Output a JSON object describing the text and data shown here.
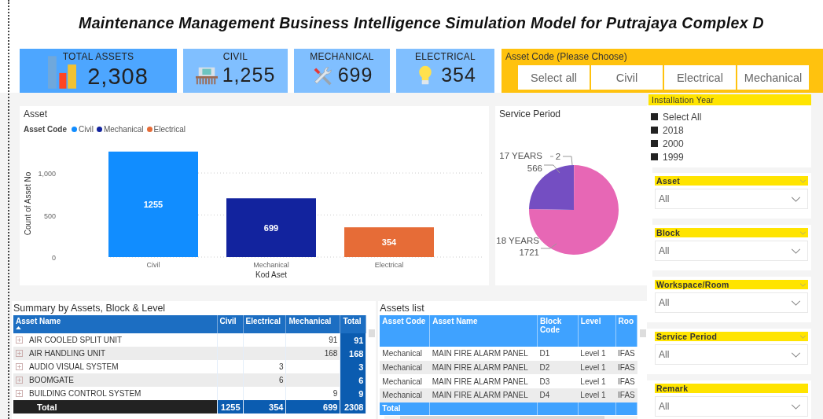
{
  "title": "Maintenance Management Business Intelligence Simulation Model for Putrajaya Complex D",
  "kpis": [
    {
      "label": "TOTAL ASSETS",
      "value": "2,308",
      "kind": "total"
    },
    {
      "label": "CIVIL",
      "value": "1,255",
      "kind": "civil"
    },
    {
      "label": "MECHANICAL",
      "value": "699",
      "kind": "mechanical"
    },
    {
      "label": "ELECTRICAL",
      "value": "354",
      "kind": "electrical"
    }
  ],
  "asset_code_slicer": {
    "title": "Asset Code (Please Choose)",
    "options": [
      {
        "label": "Select all",
        "selected": false
      },
      {
        "label": "Civil",
        "selected": false
      },
      {
        "label": "Electrical",
        "selected": false
      },
      {
        "label": "Mechanical",
        "selected": false
      }
    ]
  },
  "asset_chart": {
    "title": "Asset",
    "legend_title": "Asset Code",
    "chart_data": {
      "type": "bar",
      "xlabel": "Kod Aset",
      "ylabel": "Count of Asset No",
      "categories": [
        "Civil",
        "Mechanical",
        "Electrical"
      ],
      "series": [
        {
          "name": "Civil",
          "color": "#118dff",
          "values": [
            1255,
            null,
            null
          ]
        },
        {
          "name": "Mechanical",
          "color": "#12239e",
          "values": [
            null,
            699,
            null
          ]
        },
        {
          "name": "Electrical",
          "color": "#e66c37",
          "values": [
            null,
            null,
            354
          ]
        }
      ],
      "ylim": [
        0,
        1300
      ],
      "yticks": [
        0,
        500,
        {
          "value": 1000,
          "label": "1,000"
        }
      ],
      "data_labels": true
    }
  },
  "service_period": {
    "title": "Service Period",
    "chart_data": {
      "type": "pie",
      "categories": [
        null,
        "18 YEARS",
        "17 YEARS"
      ],
      "values": [
        2,
        1721,
        566
      ],
      "colors": [
        "#d9534f",
        "#e767b5",
        "#744ec2"
      ],
      "value_labels": [
        "2",
        "1721",
        "566"
      ]
    }
  },
  "installation_year": {
    "title": "Installation Year",
    "items": [
      {
        "label": "Select All",
        "checked": true
      },
      {
        "label": "2018",
        "checked": true
      },
      {
        "label": "2000",
        "checked": true
      },
      {
        "label": "1999",
        "checked": true
      }
    ]
  },
  "dropdowns": [
    {
      "label": "Asset",
      "value": "All",
      "header_chevron": true
    },
    {
      "label": "Block",
      "value": "All",
      "header_chevron": true
    },
    {
      "label": "Workspace/Room",
      "value": "All",
      "header_chevron": true
    },
    {
      "label": "Service Period",
      "value": "All",
      "header_chevron": true
    },
    {
      "label": "Remark",
      "value": "All",
      "header_chevron": false
    }
  ],
  "summary": {
    "title": "Summary by Assets, Block & Level",
    "columns": [
      {
        "label": "Asset Name",
        "sorted": true
      },
      {
        "label": "Civil",
        "sorted": false
      },
      {
        "label": "Electrical",
        "sorted": false
      },
      {
        "label": "Mechanical",
        "sorted": false
      },
      {
        "label": "Total",
        "sorted": false
      }
    ],
    "rows": [
      [
        "AIR COOLED SPLIT UNIT",
        null,
        null,
        "91",
        "91"
      ],
      [
        "AIR HANDLING UNIT",
        null,
        null,
        "168",
        "168"
      ],
      [
        "AUDIO VISUAL SYSTEM",
        null,
        "3",
        null,
        "3"
      ],
      [
        "BOOMGATE",
        null,
        "6",
        null,
        "6"
      ],
      [
        "BUILDING CONTROL SYSTEM",
        null,
        null,
        "9",
        "9"
      ]
    ],
    "total_row": [
      "Total",
      "1255",
      "354",
      "699",
      "2308"
    ]
  },
  "assets_list": {
    "title": "Assets list",
    "columns": [
      "Asset Code",
      "Asset Name",
      "Block Code",
      "Level",
      "Roo"
    ],
    "rows": [
      [
        "Mechanical",
        "MAIN FIRE ALARM PANEL",
        "D1",
        "Level 1",
        "IFAS"
      ],
      [
        "Mechanical",
        "MAIN FIRE ALARM PANEL",
        "D2",
        "Level 1",
        "IFAS"
      ],
      [
        "Mechanical",
        "MAIN FIRE ALARM PANEL",
        "D3",
        "Level 1",
        "IFAS"
      ],
      [
        "Mechanical",
        "MAIN FIRE ALARM PANEL",
        "D4",
        "Level 1",
        "IFAS"
      ]
    ],
    "total_label": "Total"
  }
}
